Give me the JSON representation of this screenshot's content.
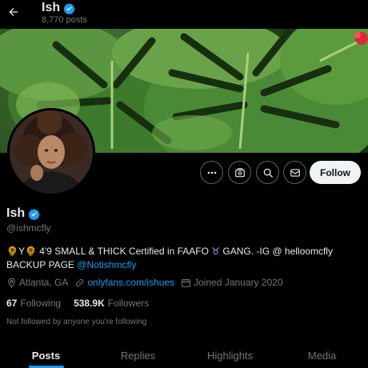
{
  "header": {
    "title": "Ish",
    "post_count": "8,770 posts",
    "back_icon": "arrow-left-icon"
  },
  "profile": {
    "name": "Ish",
    "handle": "@ishmcfly",
    "verified": true,
    "verified_color": "#1d9bf0",
    "bio": {
      "line1_emoji_a": "🌻",
      "line1_y": "Y",
      "line1_emoji_b": "🌻",
      "line1_text": " 4'9 SMALL & THICK Certified in FAAFO ",
      "line1_sign": "♉",
      "line1_tail": " GANG. -IG @ helloomcfly",
      "line2_text": "BACKUP PAGE ",
      "line2_mention": "@Notishmcfly"
    },
    "location": "Atlanta, GA",
    "website": "onlyfans.com/ishues",
    "joined": "Joined January 2020",
    "following_count": "67",
    "following_label": "Following",
    "followers_count": "538.9K",
    "followers_label": "Followers",
    "not_followed_text": "Not followed by anyone you're following"
  },
  "actions": {
    "more_icon": "more-dots-icon",
    "subscriptions_icon": "subscriptions-icon",
    "search_icon": "search-icon",
    "message_icon": "mail-icon",
    "follow_label": "Follow"
  },
  "tabs": [
    {
      "label": "Posts",
      "active": true
    },
    {
      "label": "Replies",
      "active": false
    },
    {
      "label": "Highlights",
      "active": false
    },
    {
      "label": "Media",
      "active": false
    }
  ],
  "colors": {
    "accent": "#1d9bf0",
    "background": "#000000",
    "muted": "#71767b"
  }
}
